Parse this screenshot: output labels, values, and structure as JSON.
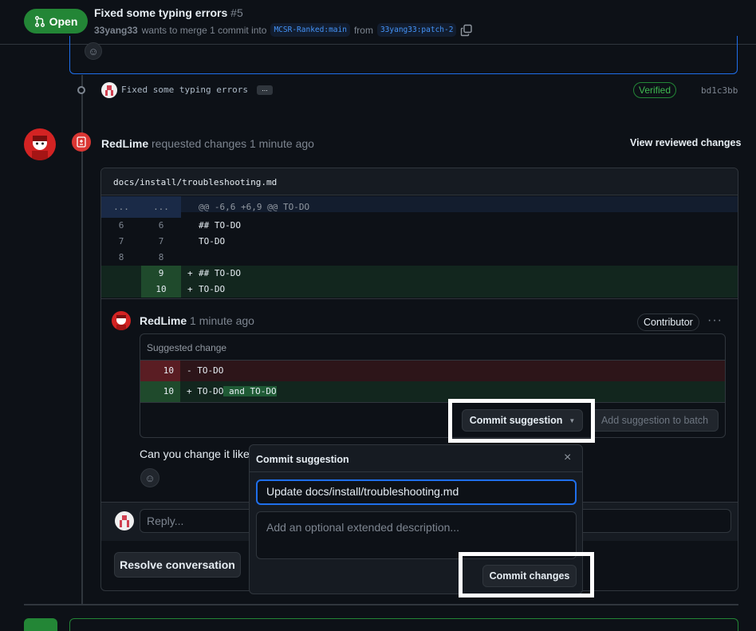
{
  "header": {
    "state": "Open",
    "title": "Fixed some typing errors",
    "number": "#5",
    "author": "33yang33",
    "merge_text_1": "wants to merge 1 commit into",
    "base_branch": "MCSR-Ranked:main",
    "from_text": "from",
    "head_branch": "33yang33:patch-2"
  },
  "commit": {
    "message": "Fixed some typing errors",
    "more": "...",
    "verified": "Verified",
    "sha": "bd1c3bb"
  },
  "review": {
    "author": "RedLime",
    "action": "requested changes",
    "time": "1 minute ago",
    "view_changes": "View reviewed changes"
  },
  "file": {
    "path": "docs/install/troubleshooting.md",
    "hunk": {
      "l1": "...",
      "l2": "...",
      "text": "@@ -6,6 +6,9 @@ TO-DO"
    },
    "lines": [
      {
        "l1": "6",
        "l2": "6",
        "prefix": "",
        "code_kw": "## TO-DO",
        "code": ""
      },
      {
        "l1": "7",
        "l2": "7",
        "prefix": "",
        "code_kw": "",
        "code": "TO-DO"
      },
      {
        "l1": "8",
        "l2": "8",
        "prefix": "",
        "code_kw": "",
        "code": ""
      }
    ],
    "added": [
      {
        "l2": "9",
        "sign": "+",
        "code_kw": "## TO-DO",
        "code": ""
      },
      {
        "l2": "10",
        "sign": "+",
        "code_kw": "",
        "code": "TO-DO"
      }
    ]
  },
  "comment": {
    "author": "RedLime",
    "time": "1 minute ago",
    "badge": "Contributor",
    "more": "···",
    "suggestion_label": "Suggested change",
    "del_line": {
      "num": "10",
      "code": "- TO-DO"
    },
    "add_line": {
      "num": "10",
      "code_start": "+ TO-DO",
      "code_highlight": " and TO-DO"
    },
    "commit_suggestion": "Commit suggestion",
    "add_to_batch": "Add suggestion to batch",
    "body": "Can you change it like"
  },
  "reply": {
    "placeholder": "Reply..."
  },
  "resolve": "Resolve conversation",
  "popover": {
    "title": "Commit suggestion",
    "close": "×",
    "message_value": "Update docs/install/troubleshooting.md",
    "description_placeholder": "Add an optional extended description...",
    "commit_changes": "Commit changes"
  },
  "colors": {
    "accent_green": "#238636",
    "accent_blue": "#1f6feb",
    "request_changes_red": "#da3633"
  }
}
